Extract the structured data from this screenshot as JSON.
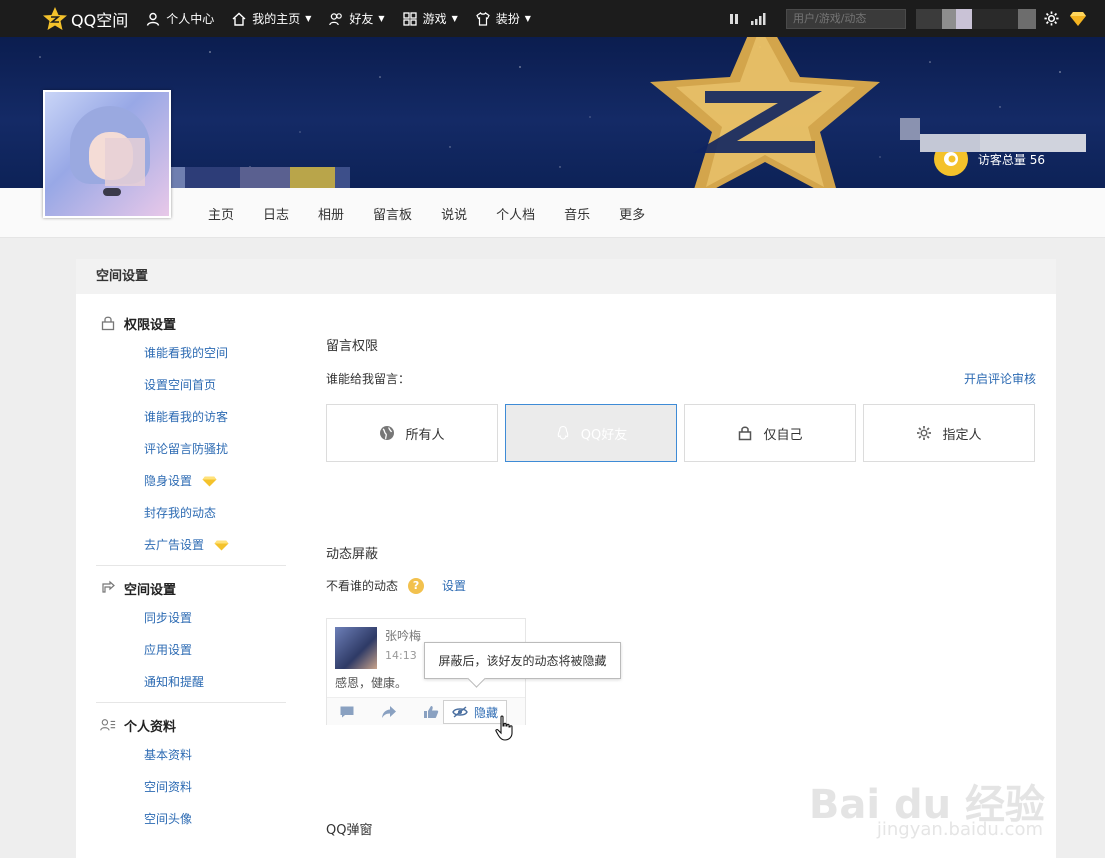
{
  "topbar": {
    "brand": "QQ空间",
    "nav": [
      {
        "label": "个人中心",
        "icon": "user-icon",
        "caret": false
      },
      {
        "label": "我的主页",
        "icon": "home-icon",
        "caret": true
      },
      {
        "label": "好友",
        "icon": "friends-icon",
        "caret": true
      },
      {
        "label": "游戏",
        "icon": "grid-icon",
        "caret": true
      },
      {
        "label": "装扮",
        "icon": "shirt-icon",
        "caret": true
      }
    ],
    "search_placeholder": "用户/游戏/动态",
    "accent": "#f4c22b"
  },
  "banner": {
    "visitor_text": "访客总量 56"
  },
  "subnav": [
    "主页",
    "日志",
    "相册",
    "留言板",
    "说说",
    "个人档",
    "音乐",
    "更多"
  ],
  "panel": {
    "title": "空间设置",
    "sidebar": {
      "groups": [
        {
          "title": "权限设置",
          "icon": "lock-icon",
          "items": [
            {
              "label": "谁能看我的空间",
              "vip": false
            },
            {
              "label": "设置空间首页",
              "vip": false
            },
            {
              "label": "谁能看我的访客",
              "vip": false
            },
            {
              "label": "评论留言防骚扰",
              "vip": false
            },
            {
              "label": "隐身设置",
              "vip": true
            },
            {
              "label": "封存我的动态",
              "vip": false
            },
            {
              "label": "去广告设置",
              "vip": true
            }
          ]
        },
        {
          "title": "空间设置",
          "icon": "sync-icon",
          "items": [
            {
              "label": "同步设置",
              "vip": false
            },
            {
              "label": "应用设置",
              "vip": false
            },
            {
              "label": "通知和提醒",
              "vip": false
            }
          ]
        },
        {
          "title": "个人资料",
          "icon": "profile-icon",
          "items": [
            {
              "label": "基本资料",
              "vip": false
            },
            {
              "label": "空间资料",
              "vip": false
            },
            {
              "label": "空间头像",
              "vip": false
            }
          ]
        }
      ]
    },
    "message_permission": {
      "title": "留言权限",
      "question": "谁能给我留言：",
      "review_link": "开启评论审核",
      "options": [
        "所有人",
        "QQ好友",
        "仅自己",
        "指定人"
      ],
      "selected": "QQ好友"
    },
    "feed_block": {
      "title": "动态屏蔽",
      "label": "不看谁的动态",
      "help": "?",
      "settings_link": "设置",
      "example": {
        "name": "张吟梅",
        "time": "14:13",
        "text": "感恩，健康。",
        "hide_label": "隐藏",
        "tooltip": "屏蔽后，该好友的动态将被隐藏"
      }
    },
    "qq_popup": {
      "title": "QQ弹窗"
    }
  },
  "watermark": {
    "main": "Bai du 经验",
    "sub": "jingyan.baidu.com"
  }
}
